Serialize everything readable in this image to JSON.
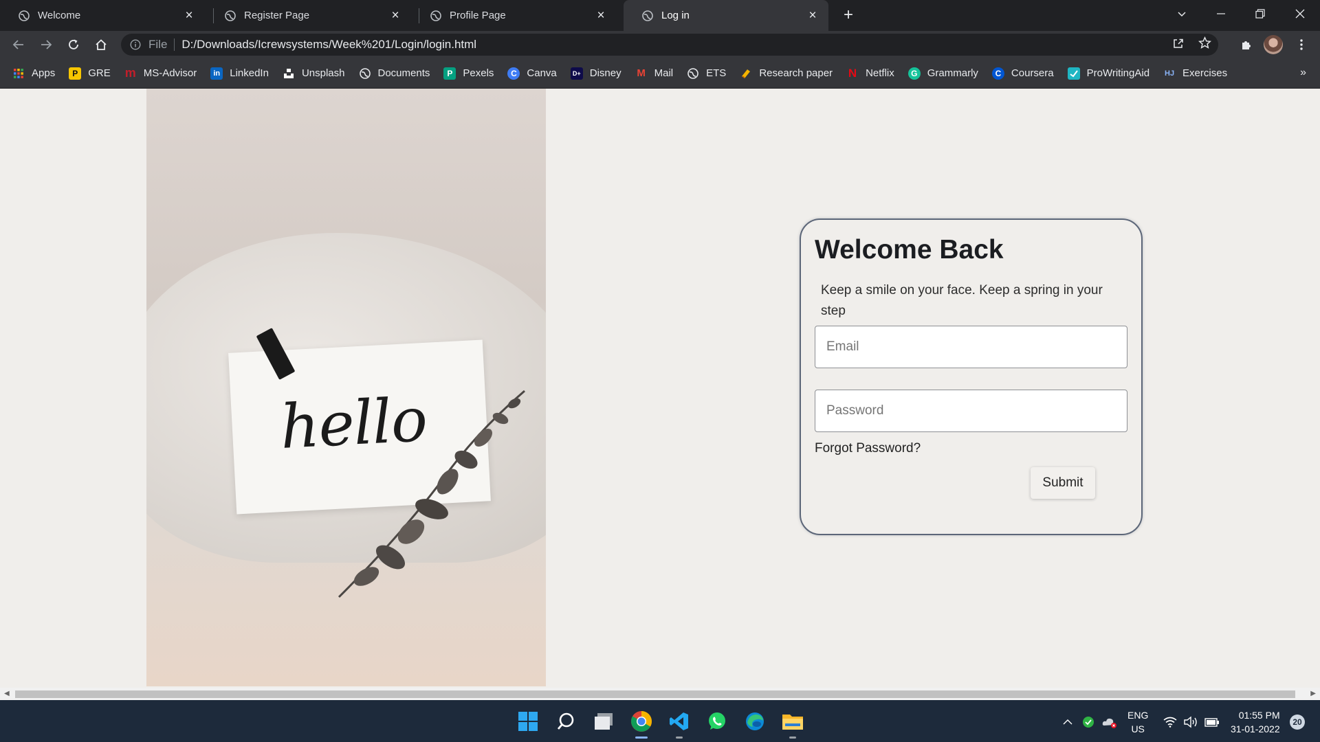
{
  "browser": {
    "tabs": [
      {
        "label": "Welcome"
      },
      {
        "label": "Register Page"
      },
      {
        "label": "Profile Page"
      },
      {
        "label": "Log in"
      }
    ],
    "active_tab": 3,
    "address": {
      "scheme_label": "File",
      "url": "D:/Downloads/Icrewsystems/Week%201/Login/login.html"
    },
    "bookmarks": [
      {
        "label": "Apps",
        "icon": "apps-grid-icon",
        "color": "#ea4335"
      },
      {
        "label": "GRE",
        "icon": "gre-icon",
        "color": "#f7c600",
        "glyph": "P"
      },
      {
        "label": "MS-Advisor",
        "icon": "ms-advisor-icon",
        "color": "#c21e2a",
        "glyph": "m"
      },
      {
        "label": "LinkedIn",
        "icon": "linkedin-icon",
        "color": "#0a66c2",
        "glyph": "in"
      },
      {
        "label": "Unsplash",
        "icon": "unsplash-icon",
        "color": "#ffffff"
      },
      {
        "label": "Documents",
        "icon": "globe-icon",
        "color": "#bdc1c6"
      },
      {
        "label": "Pexels",
        "icon": "pexels-icon",
        "color": "#05a081",
        "glyph": "P"
      },
      {
        "label": "Canva",
        "icon": "canva-icon",
        "color": "#00c4cc",
        "glyph": "C"
      },
      {
        "label": "Disney",
        "icon": "disney-icon",
        "color": "#0e0b4a",
        "glyph": "D+"
      },
      {
        "label": "Mail",
        "icon": "gmail-icon",
        "color": "#ea4335",
        "glyph": "M"
      },
      {
        "label": "ETS",
        "icon": "globe-icon",
        "color": "#bdc1c6"
      },
      {
        "label": "Research paper",
        "icon": "research-icon",
        "color": "#f4b400"
      },
      {
        "label": "Netflix",
        "icon": "netflix-icon",
        "color": "#e50914",
        "glyph": "N"
      },
      {
        "label": "Grammarly",
        "icon": "grammarly-icon",
        "color": "#15c39a",
        "glyph": "G"
      },
      {
        "label": "Coursera",
        "icon": "coursera-icon",
        "color": "#0056d2",
        "glyph": "C"
      },
      {
        "label": "ProWritingAid",
        "icon": "prowritingaid-icon",
        "color": "#1fb6c3"
      },
      {
        "label": "Exercises",
        "icon": "exercises-icon",
        "color": "#8ab4f8",
        "glyph": "HJ"
      }
    ]
  },
  "page": {
    "image_caption": "hello",
    "login": {
      "title": "Welcome Back",
      "subtitle": "Keep a smile on your face. Keep a spring in your step",
      "email_placeholder": "Email",
      "password_placeholder": "Password",
      "forgot_label": "Forgot Password?",
      "submit_label": "Submit"
    }
  },
  "taskbar": {
    "apps": [
      "windows-start-icon",
      "search-icon",
      "task-view-icon",
      "chrome-icon",
      "vscode-icon",
      "whatsapp-icon",
      "edge-icon",
      "file-explorer-icon"
    ],
    "language": {
      "line1": "ENG",
      "line2": "US"
    },
    "time": "01:55 PM",
    "date": "31-01-2022",
    "notifications": "20"
  },
  "colors": {
    "page_bg": "#f0eeeb",
    "card_border": "#5c6678",
    "taskbar_bg": "#1d2a3b"
  }
}
